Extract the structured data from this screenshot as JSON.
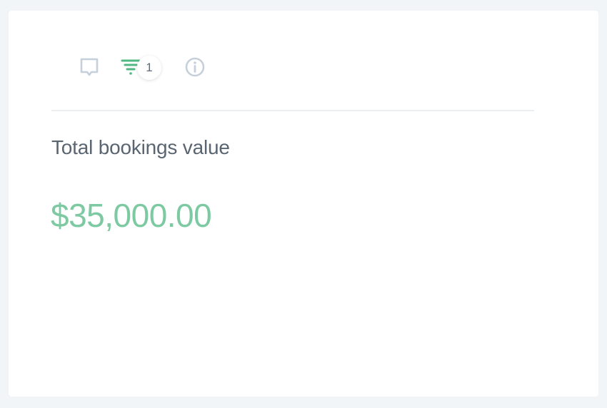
{
  "widget": {
    "toolbar": {
      "comment_icon": "comment-icon",
      "filter_icon": "filter-icon",
      "filter_count": "1",
      "info_icon": "info-icon"
    },
    "label": "Total bookings value",
    "value": "$35,000.00"
  },
  "colors": {
    "accent": "#7dc9a2",
    "filter_icon": "#52b883",
    "muted_icon": "#c6d0da",
    "label_text": "#5a6572"
  }
}
